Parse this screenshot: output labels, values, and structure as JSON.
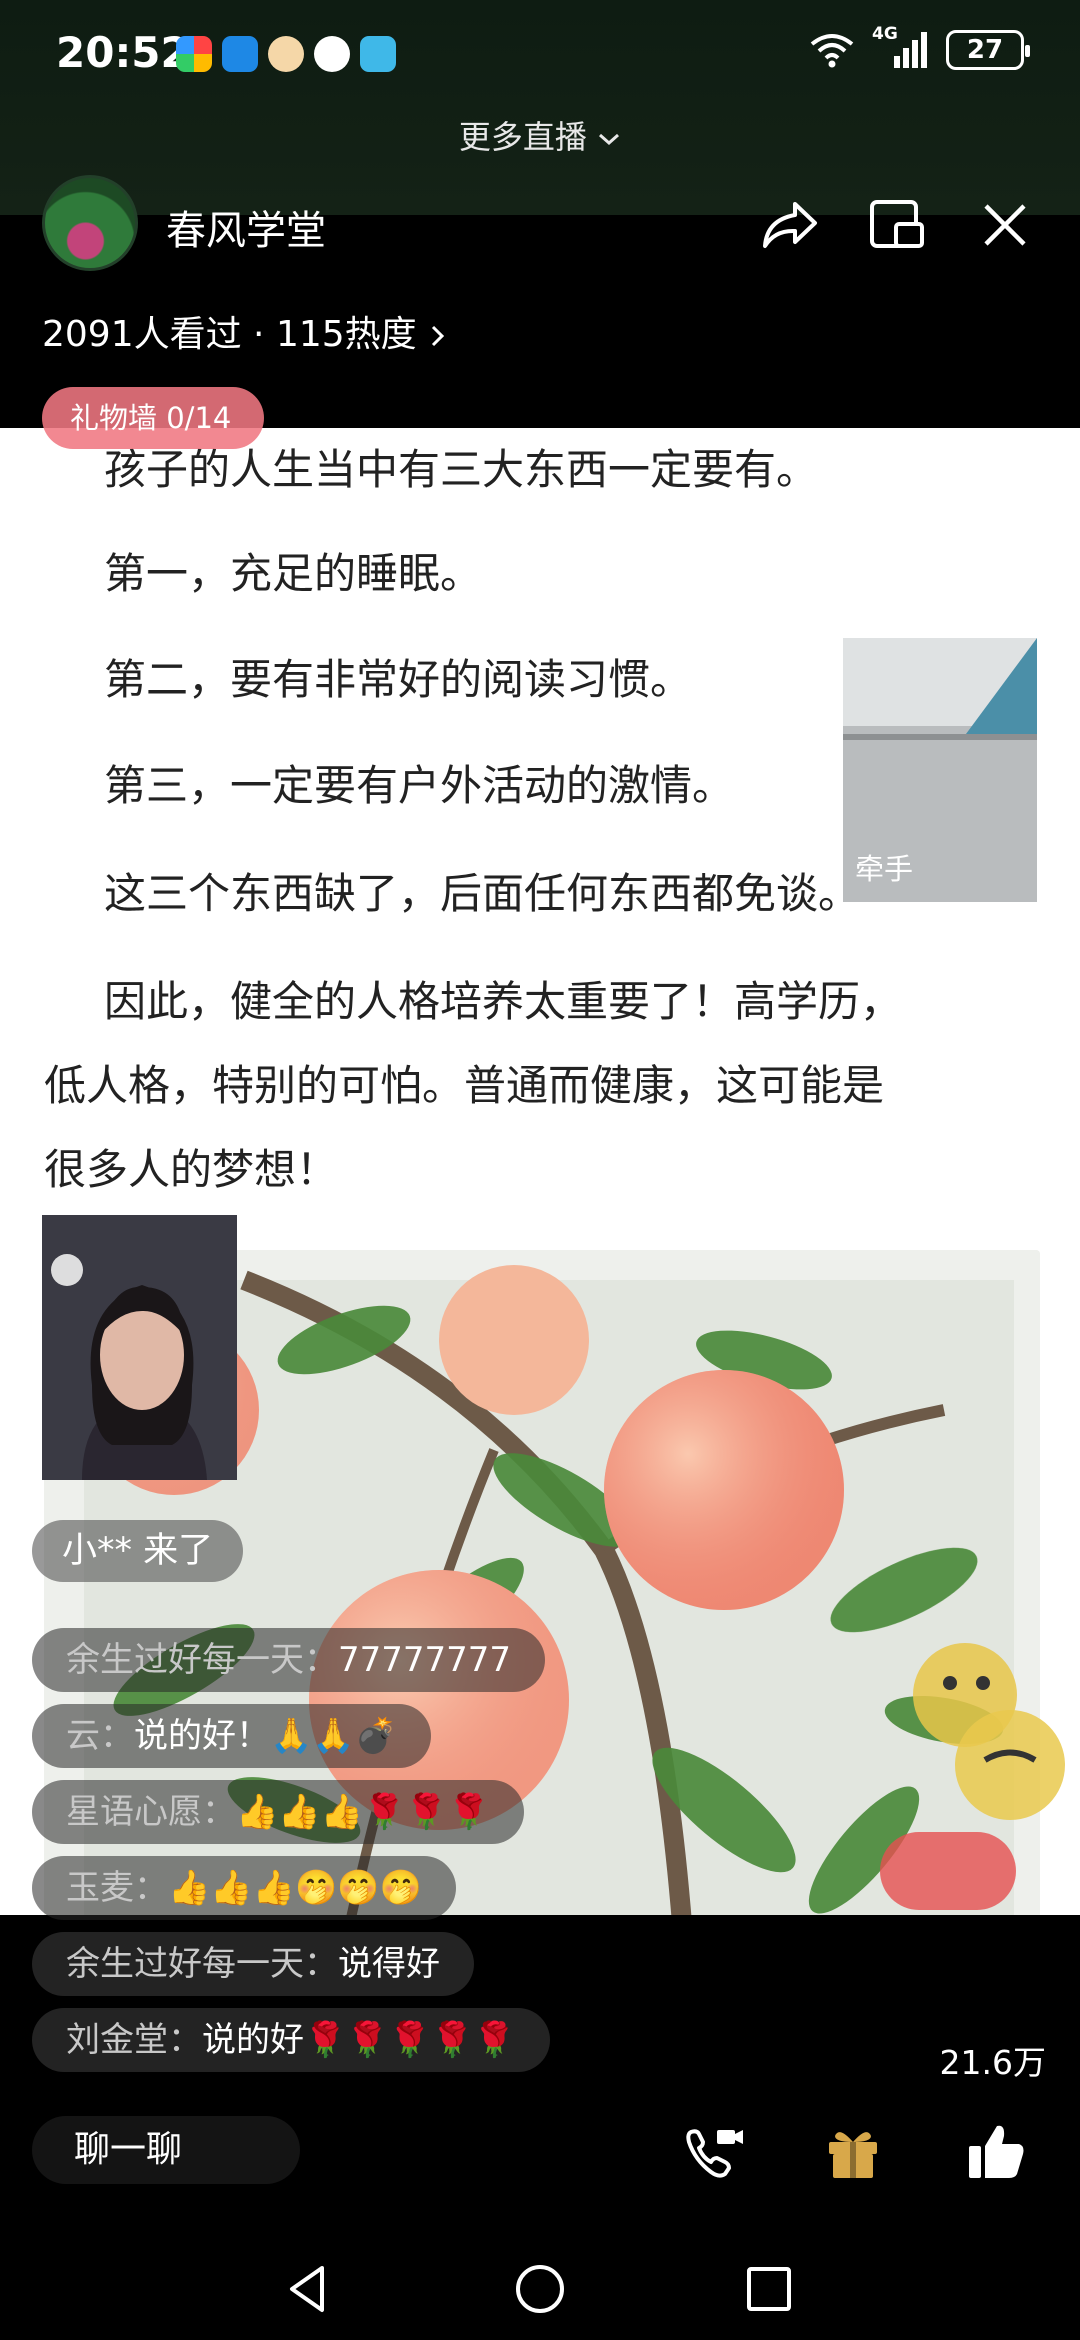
{
  "status_bar": {
    "time": "20:52",
    "network": "4G",
    "battery": "27"
  },
  "top": {
    "more_live": "更多直播"
  },
  "host": {
    "name": "春风学堂",
    "viewers": "2091人看过 · 115热度"
  },
  "gift_wall": {
    "label": "礼物墙 0/14"
  },
  "article": {
    "lines": [
      "孩子的人生当中有三大东西一定要有。",
      "第一，充足的睡眠。",
      "第二，要有非常好的阅读习惯。",
      "第三，一定要有户外活动的激情。",
      "这三个东西缺了，后面任何东西都免谈。",
      "因此，健全的人格培养太重要了！高学历，",
      "低人格，特别的可怕。普通而健康，这可能是",
      "很多人的梦想！"
    ]
  },
  "guest_cam": {
    "label": "牵手"
  },
  "join_notice": "小** 来了",
  "chat": [
    {
      "user": "余生过好每一天：",
      "text": "77777777"
    },
    {
      "user": "云：",
      "text": "说的好！🙏🙏💣"
    },
    {
      "user": "星语心愿：",
      "text": "👍👍👍🌹🌹🌹"
    },
    {
      "user": "玉麦：",
      "text": "👍👍👍🤭🤭🤭"
    },
    {
      "user": "余生过好每一天：",
      "text": "说得好"
    },
    {
      "user": "刘金堂：",
      "text": "说的好🌹🌹🌹🌹🌹"
    }
  ],
  "likes": "21.6万",
  "bottom": {
    "chat_button": "聊一聊"
  },
  "colors": {
    "gift_wall_bg": "#f07882",
    "content_bg": "#ffffff",
    "text_dark": "#222222"
  }
}
